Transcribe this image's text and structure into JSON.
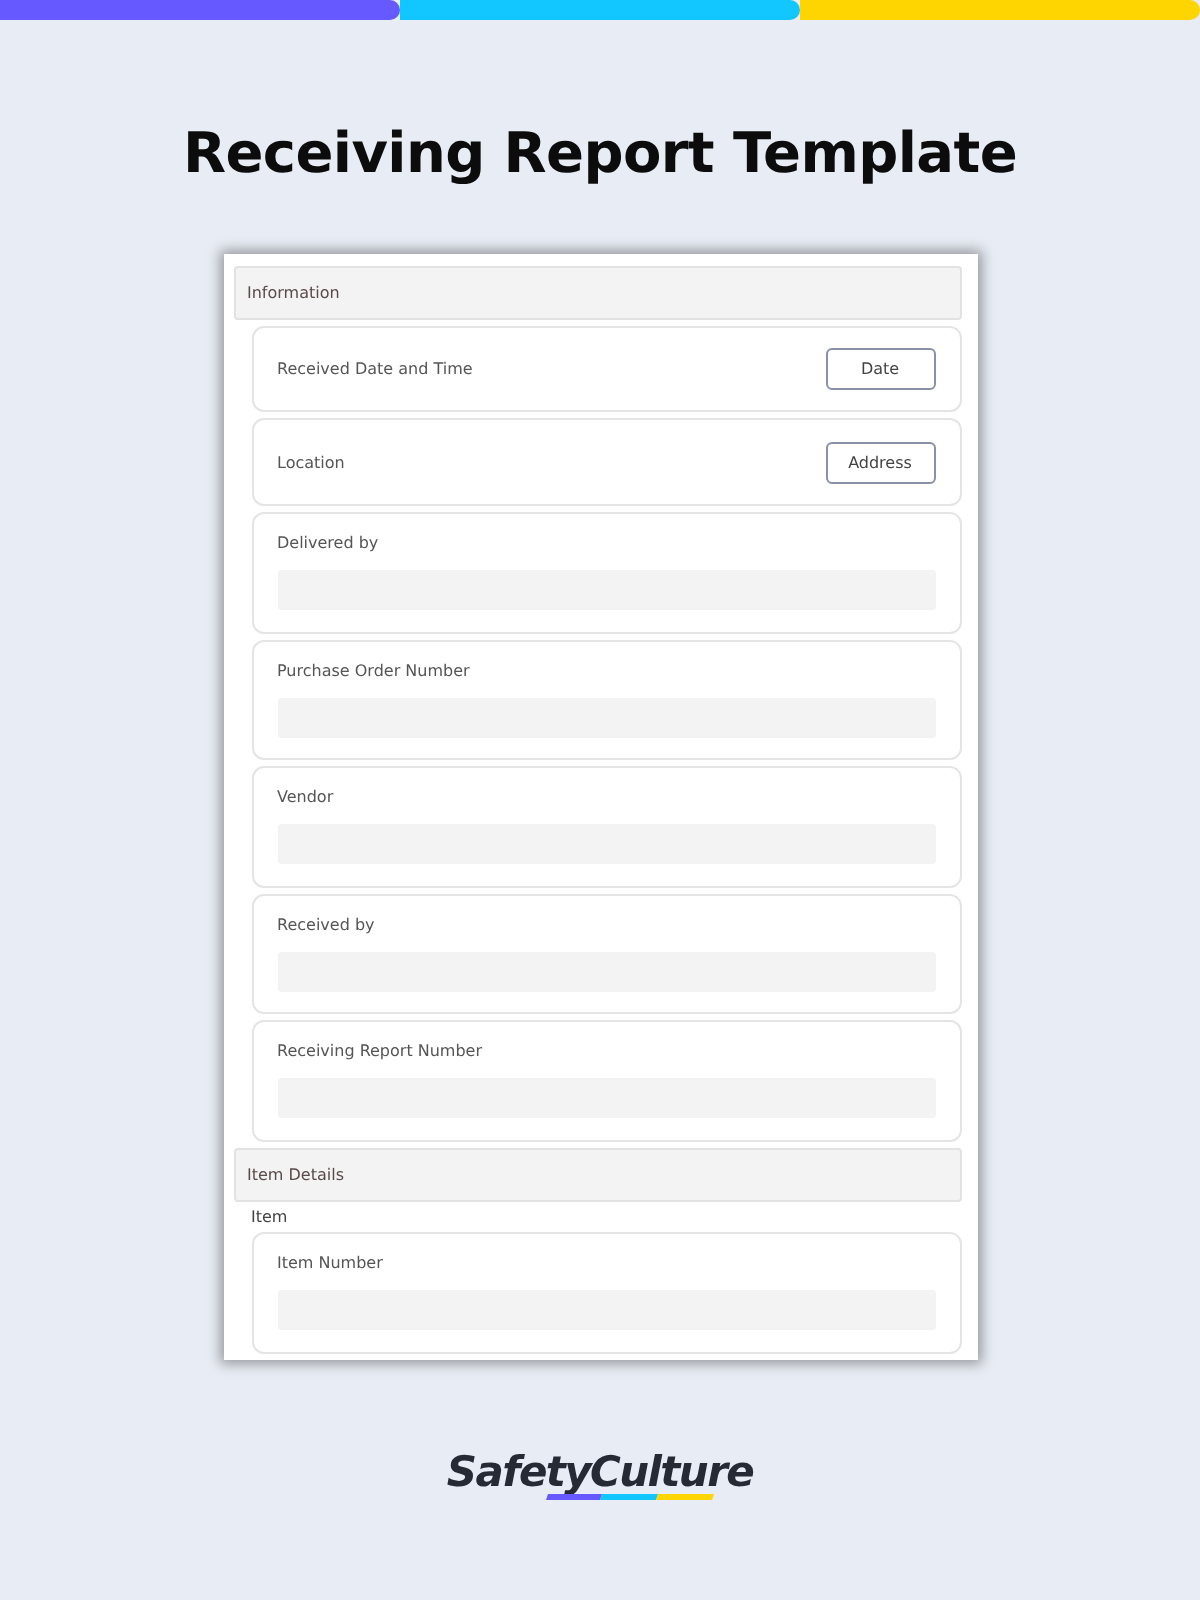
{
  "title": "Receiving Report Template",
  "sections": [
    {
      "title": "Information",
      "fields": [
        {
          "kind": "button",
          "label": "Received Date and Time",
          "button": "Date"
        },
        {
          "kind": "button",
          "label": "Location",
          "button": "Address"
        },
        {
          "kind": "text",
          "label": "Delivered by"
        },
        {
          "kind": "text",
          "label": "Purchase Order Number"
        },
        {
          "kind": "text",
          "label": "Vendor"
        },
        {
          "kind": "text",
          "label": "Received by"
        },
        {
          "kind": "text",
          "label": "Receiving Report Number"
        }
      ]
    },
    {
      "title": "Item Details",
      "group_label": "Item",
      "fields": [
        {
          "kind": "text",
          "label": "Item Number"
        }
      ]
    }
  ],
  "logo": "SafetyCulture"
}
